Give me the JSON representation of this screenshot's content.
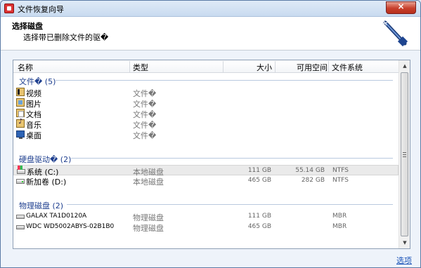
{
  "window": {
    "title": "文件恢复向导",
    "close_label": "×"
  },
  "header": {
    "title": "选择磁盘",
    "subtitle": "选择带已删除文件的驱�"
  },
  "columns": {
    "name": "名称",
    "type": "类型",
    "size": "大小",
    "free": "可用空间",
    "fs": "文件系统"
  },
  "groups": {
    "files": {
      "label": "文件� (5)"
    },
    "drives": {
      "label": "硬盘驱动� (2)"
    },
    "physical": {
      "label": "物理磁盘 (2)"
    }
  },
  "files": [
    {
      "name": "视频",
      "type": "文件�",
      "icon": "video-folder-icon"
    },
    {
      "name": "图片",
      "type": "文件�",
      "icon": "picture-folder-icon"
    },
    {
      "name": "文档",
      "type": "文件�",
      "icon": "document-folder-icon"
    },
    {
      "name": "音乐",
      "type": "文件�",
      "icon": "music-folder-icon"
    },
    {
      "name": "桌面",
      "type": "文件�",
      "icon": "desktop-icon"
    }
  ],
  "drives": [
    {
      "name": "系统 (C:)",
      "type": "本地磁盘",
      "size": "111 GB",
      "free": "55.14 GB",
      "fs": "NTFS",
      "icon": "system-drive-icon",
      "selected": true
    },
    {
      "name": "新加卷 (D:)",
      "type": "本地磁盘",
      "size": "465 GB",
      "free": "282 GB",
      "fs": "NTFS",
      "icon": "drive-icon",
      "selected": false
    }
  ],
  "physical": [
    {
      "name": "GALAX TA1D0120A",
      "type": "物理磁盘",
      "size": "111 GB",
      "fs": "MBR",
      "icon": "disk-icon"
    },
    {
      "name": "WDC WD5002ABYS-02B1B0",
      "type": "物理磁盘",
      "size": "465 GB",
      "fs": "MBR",
      "icon": "disk-icon"
    }
  ],
  "footer": {
    "options_link": "选项"
  },
  "colors": {
    "group_text": "#1e3f8f",
    "link": "#1a53b8",
    "close_button": "#c7402c"
  }
}
